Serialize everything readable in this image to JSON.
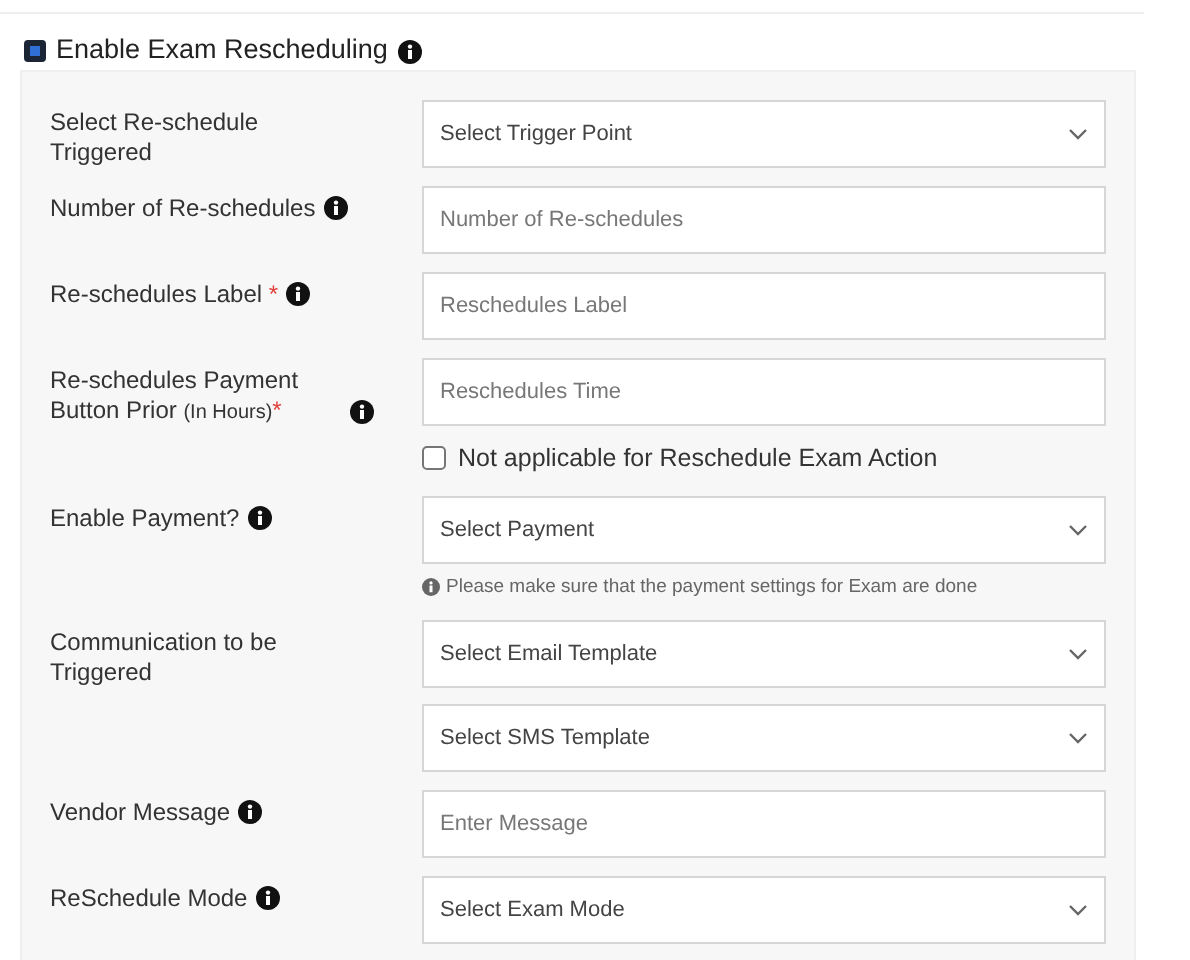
{
  "header": {
    "label": "Enable Exam Rescheduling",
    "checked": true,
    "info": true
  },
  "rows": [
    {
      "label": "Select Re-schedule Triggered",
      "info": false,
      "fields": [
        {
          "kind": "select",
          "placeholder": "Select Trigger Point"
        }
      ]
    },
    {
      "label": "Number of Re-schedules",
      "info": true,
      "fields": [
        {
          "kind": "input",
          "placeholder": "Number of Re-schedules"
        }
      ]
    },
    {
      "label": "Re-schedules Label",
      "info": true,
      "required": "*",
      "fields": [
        {
          "kind": "input",
          "placeholder": "Reschedules Label"
        }
      ]
    },
    {
      "label": "Re-schedules Payment Button Prior",
      "note": "(In Hours)",
      "info": true,
      "required": "*",
      "fields": [
        {
          "kind": "input",
          "placeholder": "Reschedules Time"
        },
        {
          "kind": "checkbox",
          "label": "Not applicable for Reschedule Exam Action",
          "checked": false
        }
      ]
    },
    {
      "label": "Enable Payment?",
      "info": true,
      "fields": [
        {
          "kind": "select",
          "placeholder": "Select Payment"
        },
        {
          "kind": "hint",
          "text": "Please make sure that the payment settings for Exam are done"
        }
      ]
    },
    {
      "label": "Communication to be Triggered",
      "info": false,
      "fields": [
        {
          "kind": "select",
          "placeholder": "Select Email Template"
        },
        {
          "kind": "select",
          "placeholder": "Select SMS Template"
        }
      ]
    },
    {
      "label": "Vendor Message",
      "info": true,
      "fields": [
        {
          "kind": "input",
          "placeholder": "Enter Message"
        }
      ]
    },
    {
      "label": "ReSchedule Mode",
      "info": true,
      "fields": [
        {
          "kind": "select",
          "placeholder": "Select Exam Mode"
        }
      ]
    }
  ]
}
